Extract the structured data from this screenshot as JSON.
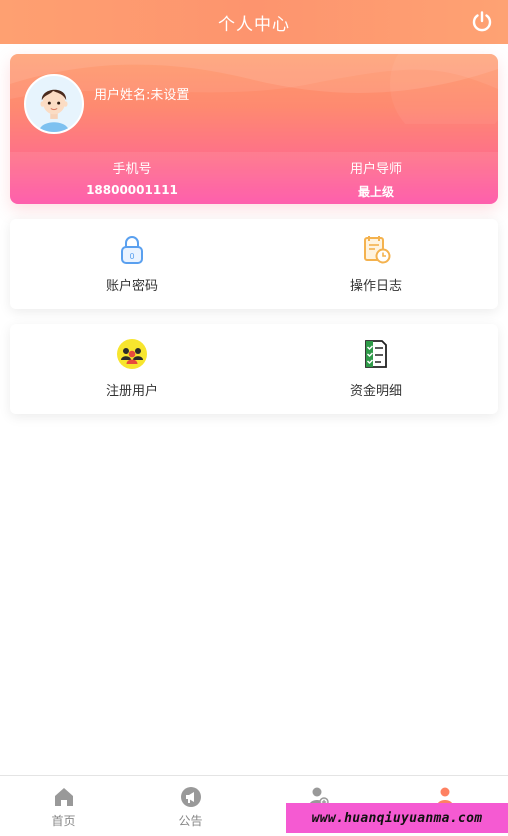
{
  "header": {
    "title": "个人中心",
    "power_icon": "power-icon"
  },
  "profile": {
    "name_label": "用户姓名:未设置",
    "stats": [
      {
        "label": "手机号",
        "value": "18800001111"
      },
      {
        "label": "用户导师",
        "value": "最上级"
      }
    ]
  },
  "menus": [
    {
      "label": "账户密码",
      "icon": "lock-icon"
    },
    {
      "label": "操作日志",
      "icon": "log-clock-icon"
    },
    {
      "label": "注册用户",
      "icon": "users-icon"
    },
    {
      "label": "资金明细",
      "icon": "checklist-icon"
    }
  ],
  "tabbar": {
    "tabs": [
      {
        "label": "首页",
        "icon": "home-icon"
      },
      {
        "label": "公告",
        "icon": "megaphone-icon"
      },
      {
        "label": "",
        "icon": "user-add-icon"
      },
      {
        "label": "",
        "icon": "user-icon"
      }
    ]
  },
  "watermark": {
    "text": "www.huanqiuyuanma.com"
  },
  "colors": {
    "accent": "#fe8162",
    "header": "#fd946e",
    "card_bottom": "#fe52a6"
  }
}
